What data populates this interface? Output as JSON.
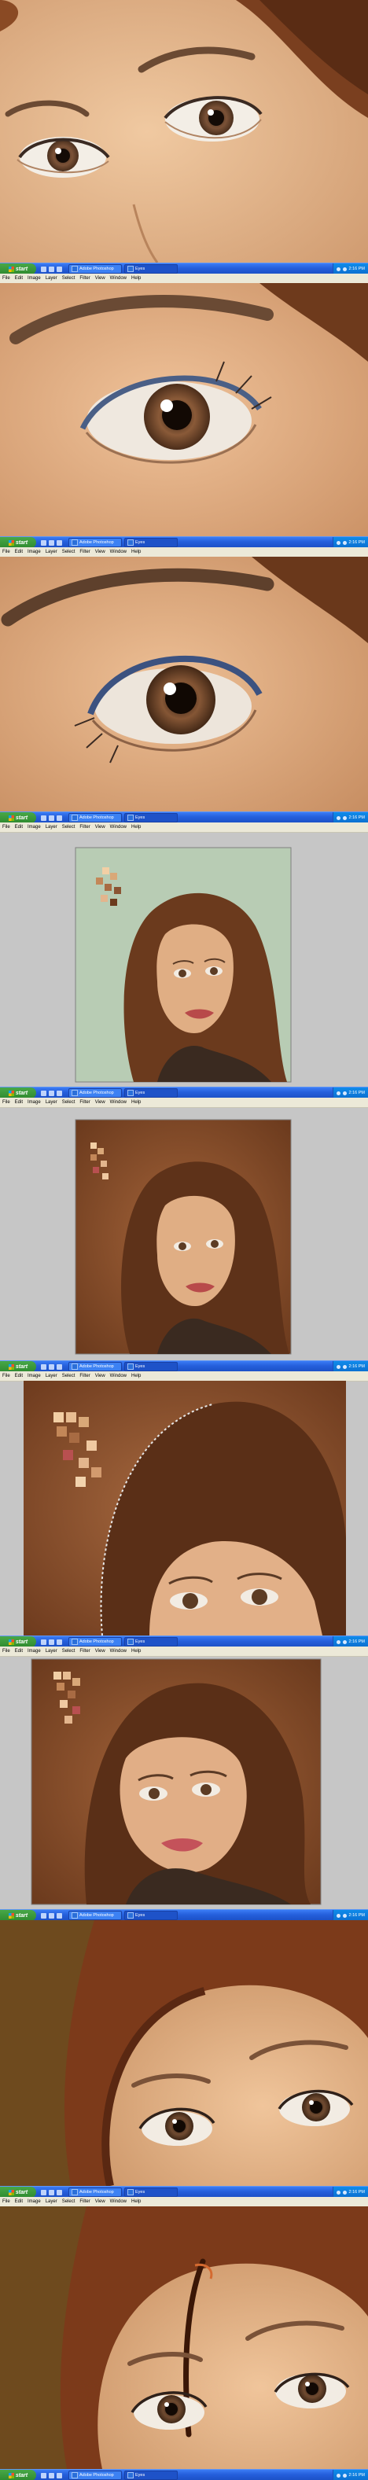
{
  "menu": [
    "File",
    "Edit",
    "Image",
    "Layer",
    "Select",
    "Filter",
    "View",
    "Window",
    "Help"
  ],
  "taskbar": {
    "start_label": "start",
    "tasks": [
      "Adobe Photoshop",
      "Eyes"
    ],
    "clock": "2:16 PM"
  },
  "colors": {
    "skin": "#e3b58d",
    "hair": "#6b3a1d",
    "background_green": "#b8ccb4",
    "background_brown": "#7a4526",
    "xp_blue": "#245edb",
    "start_green": "#3a9a3a"
  }
}
